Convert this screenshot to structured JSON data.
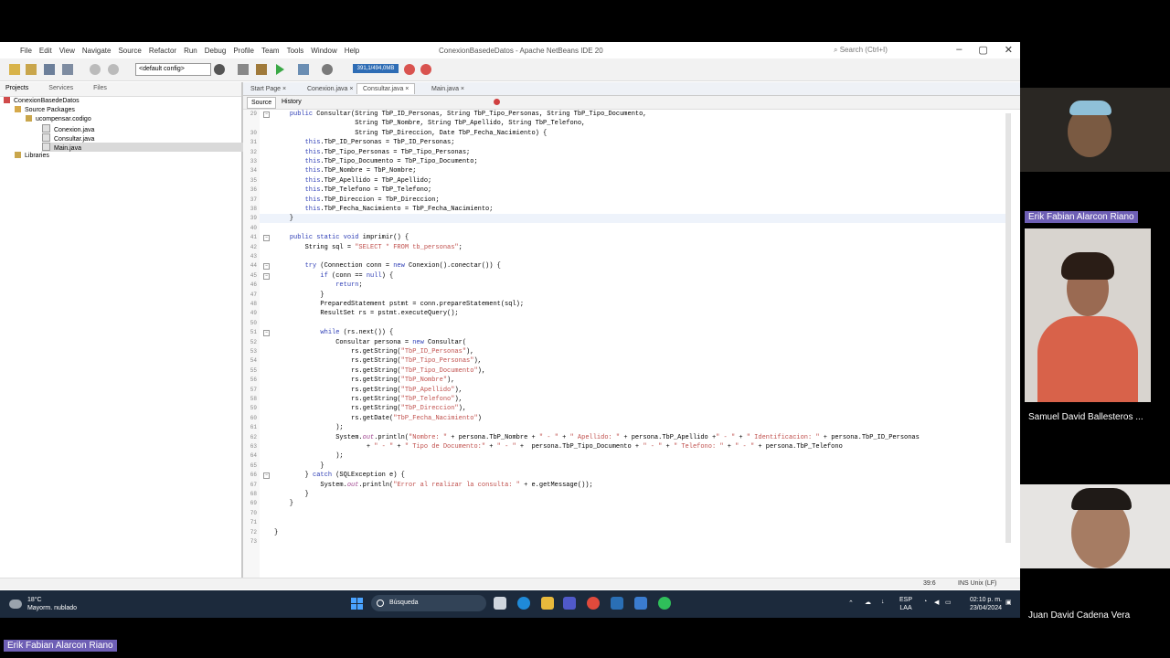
{
  "window": {
    "title": "ConexionBasedeDatos - Apache NetBeans IDE 20",
    "menu": [
      "File",
      "Edit",
      "View",
      "Navigate",
      "Source",
      "Refactor",
      "Run",
      "Debug",
      "Profile",
      "Team",
      "Tools",
      "Window",
      "Help"
    ],
    "search_placeholder": "Search (Ctrl+I)"
  },
  "toolbar": {
    "config": "<default config>",
    "memory": "391,1/494,0MB"
  },
  "projects_panel": {
    "tabs": [
      "Projects",
      "Services",
      "Files"
    ],
    "tree": {
      "project": "ConexionBasedeDatos",
      "source_packages": "Source Packages",
      "package": "ucompensar.codigo",
      "files": [
        "Conexion.java",
        "Consultar.java",
        "Main.java"
      ],
      "selected_file": "Main.java",
      "libraries": "Libraries"
    }
  },
  "editor": {
    "tabs": [
      "Start Page",
      "Conexion.java",
      "Consultar.java",
      "Main.java"
    ],
    "active_tab": "Consultar.java",
    "source_label": "Source",
    "history_label": "History",
    "lines": [
      {
        "n": "29",
        "t": "    public Consultar(String TbP_ID_Personas, String TbP_Tipo_Personas, String TbP_Tipo_Documento,"
      },
      {
        "n": "",
        "t": "                     String TbP_Nombre, String TbP_Apellido, String TbP_Telefono,"
      },
      {
        "n": "30",
        "t": "                     String TbP_Direccion, Date TbP_Fecha_Nacimiento) {"
      },
      {
        "n": "31",
        "t": "        this.TbP_ID_Personas = TbP_ID_Personas;"
      },
      {
        "n": "32",
        "t": "        this.TbP_Tipo_Personas = TbP_Tipo_Personas;"
      },
      {
        "n": "33",
        "t": "        this.TbP_Tipo_Documento = TbP_Tipo_Documento;"
      },
      {
        "n": "34",
        "t": "        this.TbP_Nombre = TbP_Nombre;"
      },
      {
        "n": "35",
        "t": "        this.TbP_Apellido = TbP_Apellido;"
      },
      {
        "n": "36",
        "t": "        this.TbP_Telefono = TbP_Telefono;"
      },
      {
        "n": "37",
        "t": "        this.TbP_Direccion = TbP_Direccion;"
      },
      {
        "n": "38",
        "t": "        this.TbP_Fecha_Nacimiento = TbP_Fecha_Nacimiento;"
      },
      {
        "n": "39",
        "t": "    }"
      },
      {
        "n": "40",
        "t": ""
      },
      {
        "n": "41",
        "t": "    public static void imprimir() {"
      },
      {
        "n": "42",
        "t": "        String sql = \"SELECT * FROM tb_personas\";"
      },
      {
        "n": "43",
        "t": ""
      },
      {
        "n": "44",
        "t": "        try (Connection conn = new Conexion().conectar()) {"
      },
      {
        "n": "45",
        "t": "            if (conn == null) {"
      },
      {
        "n": "46",
        "t": "                return;"
      },
      {
        "n": "47",
        "t": "            }"
      },
      {
        "n": "48",
        "t": "            PreparedStatement pstmt = conn.prepareStatement(sql);"
      },
      {
        "n": "49",
        "t": "            ResultSet rs = pstmt.executeQuery();"
      },
      {
        "n": "50",
        "t": ""
      },
      {
        "n": "51",
        "t": "            while (rs.next()) {"
      },
      {
        "n": "52",
        "t": "                Consultar persona = new Consultar("
      },
      {
        "n": "53",
        "t": "                    rs.getString(\"TbP_ID_Personas\"),"
      },
      {
        "n": "54",
        "t": "                    rs.getString(\"TbP_Tipo_Personas\"),"
      },
      {
        "n": "55",
        "t": "                    rs.getString(\"TbP_Tipo_Documento\"),"
      },
      {
        "n": "56",
        "t": "                    rs.getString(\"TbP_Nombre\"),"
      },
      {
        "n": "57",
        "t": "                    rs.getString(\"TbP_Apellido\"),"
      },
      {
        "n": "58",
        "t": "                    rs.getString(\"TbP_Telefono\"),"
      },
      {
        "n": "59",
        "t": "                    rs.getString(\"TbP_Direccion\"),"
      },
      {
        "n": "60",
        "t": "                    rs.getDate(\"TbP_Fecha_Nacimiento\")"
      },
      {
        "n": "61",
        "t": "                );"
      },
      {
        "n": "62",
        "t": "                System.out.println(\"Nombre: \" + persona.TbP_Nombre + \" - \" + \" Apellido: \" + persona.TbP_Apellido +\" - \" + \" Identificacion: \" + persona.TbP_ID_Personas"
      },
      {
        "n": "63",
        "t": "                        + \" - \" + \" Tipo de Documento:\" + \" - \" +  persona.TbP_Tipo_Documento + \" - \" + \" Telefono: \" + \" - \" + persona.TbP_Telefono"
      },
      {
        "n": "64",
        "t": "                );"
      },
      {
        "n": "65",
        "t": "            }"
      },
      {
        "n": "66",
        "t": "        } catch (SQLException e) {"
      },
      {
        "n": "67",
        "t": "            System.out.println(\"Error al realizar la consulta: \" + e.getMessage());"
      },
      {
        "n": "68",
        "t": "        }"
      },
      {
        "n": "69",
        "t": "    }"
      },
      {
        "n": "70",
        "t": ""
      },
      {
        "n": "71",
        "t": ""
      },
      {
        "n": "72",
        "t": "}"
      },
      {
        "n": "73",
        "t": ""
      }
    ]
  },
  "status": {
    "position": "39:6",
    "mode": "INS Unix (LF)"
  },
  "taskbar": {
    "weather_temp": "18°C",
    "weather_desc": "Mayorm. nublado",
    "search": "Búsqueda",
    "lang": "ESP",
    "lang2": "LAA",
    "time": "02:10 p. m.",
    "date": "23/04/2024"
  },
  "participants": {
    "tile2_name": "Erik Fabian Alarcon Riano",
    "tile3_name": "Samuel David Ballesteros ...",
    "tile4_name": "Juan David Cadena Vera",
    "bottom_name": "Erik Fabian Alarcon Riano"
  },
  "colors": {
    "keyword": "#2d3db5",
    "field": "#a04590",
    "string": "#c0504d",
    "chip": "#6e5fb5"
  }
}
